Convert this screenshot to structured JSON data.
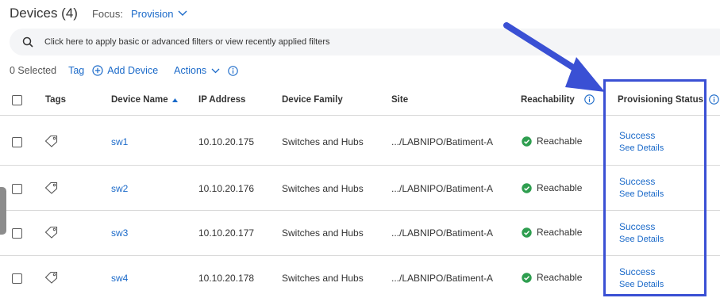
{
  "header": {
    "title": "Devices (4)",
    "focus_label": "Focus:",
    "focus_value": "Provision"
  },
  "search": {
    "text": "Click here to apply basic or advanced filters or view recently applied filters"
  },
  "toolbar": {
    "selected": "0 Selected",
    "tag": "Tag",
    "add_device": "Add Device",
    "actions": "Actions"
  },
  "columns": {
    "tags": "Tags",
    "device_name": "Device Name",
    "ip": "IP Address",
    "family": "Device Family",
    "site": "Site",
    "reachability": "Reachability",
    "provisioning": "Provisioning Status"
  },
  "rows": [
    {
      "name": "sw1",
      "ip": "10.10.20.175",
      "family": "Switches and Hubs",
      "site": ".../LABNIPO/Batiment-A",
      "reachability": "Reachable",
      "status": "Success",
      "details": "See Details"
    },
    {
      "name": "sw2",
      "ip": "10.10.20.176",
      "family": "Switches and Hubs",
      "site": ".../LABNIPO/Batiment-A",
      "reachability": "Reachable",
      "status": "Success",
      "details": "See Details"
    },
    {
      "name": "sw3",
      "ip": "10.10.20.177",
      "family": "Switches and Hubs",
      "site": ".../LABNIPO/Batiment-A",
      "reachability": "Reachable",
      "status": "Success",
      "details": "See Details"
    },
    {
      "name": "sw4",
      "ip": "10.10.20.178",
      "family": "Switches and Hubs",
      "site": ".../LABNIPO/Batiment-A",
      "reachability": "Reachable",
      "status": "Success",
      "details": "See Details"
    }
  ],
  "colors": {
    "link": "#1b6ac9",
    "reachable": "#2e9e4f",
    "annotation": "#3a50d4"
  },
  "icons": [
    "search-icon",
    "chevron-down-icon",
    "add-circle-icon",
    "info-icon",
    "tag-icon",
    "check-circle-icon",
    "sort-asc-icon",
    "arrow-annotation"
  ]
}
